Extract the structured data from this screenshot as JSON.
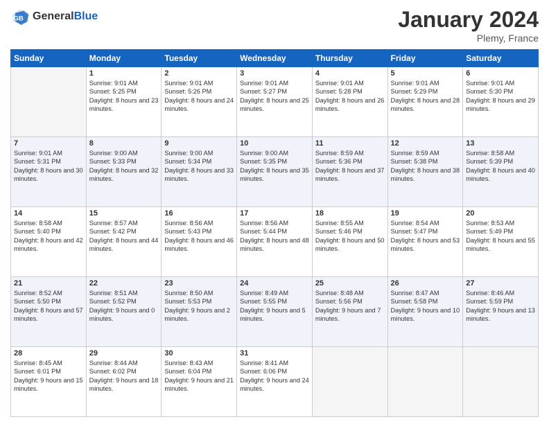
{
  "header": {
    "logo_line1": "General",
    "logo_line2": "Blue",
    "month_year": "January 2024",
    "location": "Plemy, France"
  },
  "days_of_week": [
    "Sunday",
    "Monday",
    "Tuesday",
    "Wednesday",
    "Thursday",
    "Friday",
    "Saturday"
  ],
  "weeks": [
    [
      {
        "day": "",
        "sunrise": "",
        "sunset": "",
        "daylight": "",
        "empty": true
      },
      {
        "day": "1",
        "sunrise": "Sunrise: 9:01 AM",
        "sunset": "Sunset: 5:25 PM",
        "daylight": "Daylight: 8 hours and 23 minutes.",
        "empty": false
      },
      {
        "day": "2",
        "sunrise": "Sunrise: 9:01 AM",
        "sunset": "Sunset: 5:26 PM",
        "daylight": "Daylight: 8 hours and 24 minutes.",
        "empty": false
      },
      {
        "day": "3",
        "sunrise": "Sunrise: 9:01 AM",
        "sunset": "Sunset: 5:27 PM",
        "daylight": "Daylight: 8 hours and 25 minutes.",
        "empty": false
      },
      {
        "day": "4",
        "sunrise": "Sunrise: 9:01 AM",
        "sunset": "Sunset: 5:28 PM",
        "daylight": "Daylight: 8 hours and 26 minutes.",
        "empty": false
      },
      {
        "day": "5",
        "sunrise": "Sunrise: 9:01 AM",
        "sunset": "Sunset: 5:29 PM",
        "daylight": "Daylight: 8 hours and 28 minutes.",
        "empty": false
      },
      {
        "day": "6",
        "sunrise": "Sunrise: 9:01 AM",
        "sunset": "Sunset: 5:30 PM",
        "daylight": "Daylight: 8 hours and 29 minutes.",
        "empty": false
      }
    ],
    [
      {
        "day": "7",
        "sunrise": "Sunrise: 9:01 AM",
        "sunset": "Sunset: 5:31 PM",
        "daylight": "Daylight: 8 hours and 30 minutes.",
        "empty": false
      },
      {
        "day": "8",
        "sunrise": "Sunrise: 9:00 AM",
        "sunset": "Sunset: 5:33 PM",
        "daylight": "Daylight: 8 hours and 32 minutes.",
        "empty": false
      },
      {
        "day": "9",
        "sunrise": "Sunrise: 9:00 AM",
        "sunset": "Sunset: 5:34 PM",
        "daylight": "Daylight: 8 hours and 33 minutes.",
        "empty": false
      },
      {
        "day": "10",
        "sunrise": "Sunrise: 9:00 AM",
        "sunset": "Sunset: 5:35 PM",
        "daylight": "Daylight: 8 hours and 35 minutes.",
        "empty": false
      },
      {
        "day": "11",
        "sunrise": "Sunrise: 8:59 AM",
        "sunset": "Sunset: 5:36 PM",
        "daylight": "Daylight: 8 hours and 37 minutes.",
        "empty": false
      },
      {
        "day": "12",
        "sunrise": "Sunrise: 8:59 AM",
        "sunset": "Sunset: 5:38 PM",
        "daylight": "Daylight: 8 hours and 38 minutes.",
        "empty": false
      },
      {
        "day": "13",
        "sunrise": "Sunrise: 8:58 AM",
        "sunset": "Sunset: 5:39 PM",
        "daylight": "Daylight: 8 hours and 40 minutes.",
        "empty": false
      }
    ],
    [
      {
        "day": "14",
        "sunrise": "Sunrise: 8:58 AM",
        "sunset": "Sunset: 5:40 PM",
        "daylight": "Daylight: 8 hours and 42 minutes.",
        "empty": false
      },
      {
        "day": "15",
        "sunrise": "Sunrise: 8:57 AM",
        "sunset": "Sunset: 5:42 PM",
        "daylight": "Daylight: 8 hours and 44 minutes.",
        "empty": false
      },
      {
        "day": "16",
        "sunrise": "Sunrise: 8:56 AM",
        "sunset": "Sunset: 5:43 PM",
        "daylight": "Daylight: 8 hours and 46 minutes.",
        "empty": false
      },
      {
        "day": "17",
        "sunrise": "Sunrise: 8:56 AM",
        "sunset": "Sunset: 5:44 PM",
        "daylight": "Daylight: 8 hours and 48 minutes.",
        "empty": false
      },
      {
        "day": "18",
        "sunrise": "Sunrise: 8:55 AM",
        "sunset": "Sunset: 5:46 PM",
        "daylight": "Daylight: 8 hours and 50 minutes.",
        "empty": false
      },
      {
        "day": "19",
        "sunrise": "Sunrise: 8:54 AM",
        "sunset": "Sunset: 5:47 PM",
        "daylight": "Daylight: 8 hours and 53 minutes.",
        "empty": false
      },
      {
        "day": "20",
        "sunrise": "Sunrise: 8:53 AM",
        "sunset": "Sunset: 5:49 PM",
        "daylight": "Daylight: 8 hours and 55 minutes.",
        "empty": false
      }
    ],
    [
      {
        "day": "21",
        "sunrise": "Sunrise: 8:52 AM",
        "sunset": "Sunset: 5:50 PM",
        "daylight": "Daylight: 8 hours and 57 minutes.",
        "empty": false
      },
      {
        "day": "22",
        "sunrise": "Sunrise: 8:51 AM",
        "sunset": "Sunset: 5:52 PM",
        "daylight": "Daylight: 9 hours and 0 minutes.",
        "empty": false
      },
      {
        "day": "23",
        "sunrise": "Sunrise: 8:50 AM",
        "sunset": "Sunset: 5:53 PM",
        "daylight": "Daylight: 9 hours and 2 minutes.",
        "empty": false
      },
      {
        "day": "24",
        "sunrise": "Sunrise: 8:49 AM",
        "sunset": "Sunset: 5:55 PM",
        "daylight": "Daylight: 9 hours and 5 minutes.",
        "empty": false
      },
      {
        "day": "25",
        "sunrise": "Sunrise: 8:48 AM",
        "sunset": "Sunset: 5:56 PM",
        "daylight": "Daylight: 9 hours and 7 minutes.",
        "empty": false
      },
      {
        "day": "26",
        "sunrise": "Sunrise: 8:47 AM",
        "sunset": "Sunset: 5:58 PM",
        "daylight": "Daylight: 9 hours and 10 minutes.",
        "empty": false
      },
      {
        "day": "27",
        "sunrise": "Sunrise: 8:46 AM",
        "sunset": "Sunset: 5:59 PM",
        "daylight": "Daylight: 9 hours and 13 minutes.",
        "empty": false
      }
    ],
    [
      {
        "day": "28",
        "sunrise": "Sunrise: 8:45 AM",
        "sunset": "Sunset: 6:01 PM",
        "daylight": "Daylight: 9 hours and 15 minutes.",
        "empty": false
      },
      {
        "day": "29",
        "sunrise": "Sunrise: 8:44 AM",
        "sunset": "Sunset: 6:02 PM",
        "daylight": "Daylight: 9 hours and 18 minutes.",
        "empty": false
      },
      {
        "day": "30",
        "sunrise": "Sunrise: 8:43 AM",
        "sunset": "Sunset: 6:04 PM",
        "daylight": "Daylight: 9 hours and 21 minutes.",
        "empty": false
      },
      {
        "day": "31",
        "sunrise": "Sunrise: 8:41 AM",
        "sunset": "Sunset: 6:06 PM",
        "daylight": "Daylight: 9 hours and 24 minutes.",
        "empty": false
      },
      {
        "day": "",
        "sunrise": "",
        "sunset": "",
        "daylight": "",
        "empty": true
      },
      {
        "day": "",
        "sunrise": "",
        "sunset": "",
        "daylight": "",
        "empty": true
      },
      {
        "day": "",
        "sunrise": "",
        "sunset": "",
        "daylight": "",
        "empty": true
      }
    ]
  ]
}
